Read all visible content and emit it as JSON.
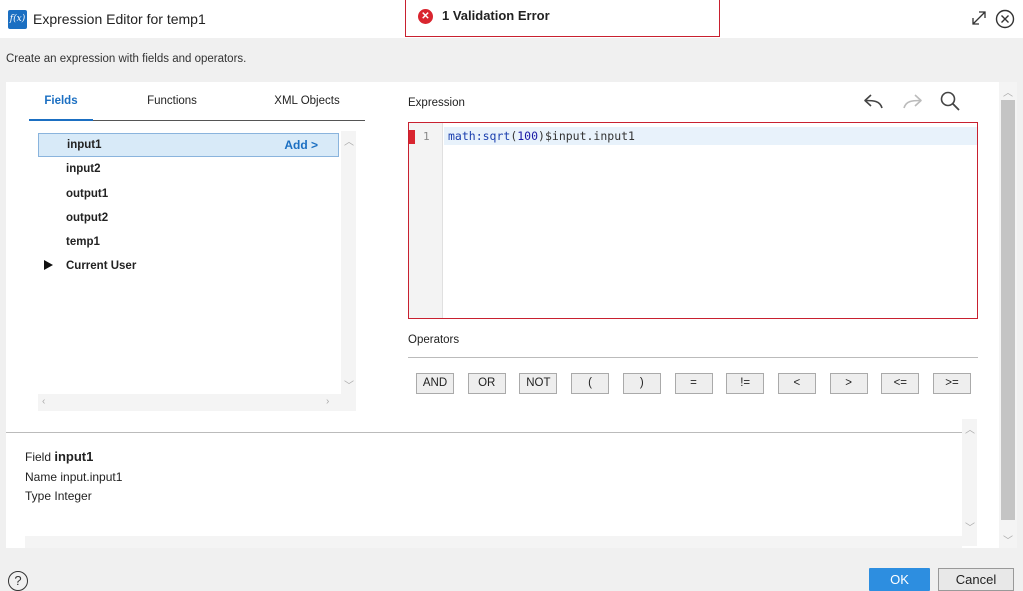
{
  "window": {
    "logo": "f(x)",
    "title": "Expression Editor for temp1"
  },
  "validation": {
    "icon": "error-circle-icon",
    "text": "1 Validation Error",
    "color": "#c8202f"
  },
  "subtitle": "Create an expression with fields and operators.",
  "tabs": [
    {
      "label": "Fields",
      "active": true
    },
    {
      "label": "Functions",
      "active": false
    },
    {
      "label": "XML Objects",
      "active": false
    }
  ],
  "fields": [
    {
      "name": "input1",
      "selected": true
    },
    {
      "name": "input2",
      "selected": false
    },
    {
      "name": "output1",
      "selected": false
    },
    {
      "name": "output2",
      "selected": false
    },
    {
      "name": "temp1",
      "selected": false
    },
    {
      "name": "Current User",
      "expandable": true
    }
  ],
  "add_label": "Add >",
  "expression": {
    "label": "Expression",
    "line_number": "1",
    "code": {
      "fn": "math:sqrt",
      "open": "(",
      "num": "100",
      "close": ")",
      "var": "$input.input1"
    }
  },
  "toolbar": {
    "undo_icon": "undo-icon",
    "redo_icon": "redo-icon",
    "search_icon": "search-icon"
  },
  "operators": {
    "label": "Operators",
    "items": [
      "AND",
      "OR",
      "NOT",
      "(",
      ")",
      "=",
      "!=",
      "<",
      ">",
      "<=",
      ">="
    ]
  },
  "info": {
    "field_label": "Field",
    "field_value": "input1",
    "name_label": "Name",
    "name_value": "input.input1",
    "type_label": "Type",
    "type_value": "Integer"
  },
  "buttons": {
    "ok": "OK",
    "cancel": "Cancel"
  },
  "colors": {
    "accent": "#1b6fc2",
    "primary_button": "#2d8ee0",
    "error": "#d9252f"
  }
}
